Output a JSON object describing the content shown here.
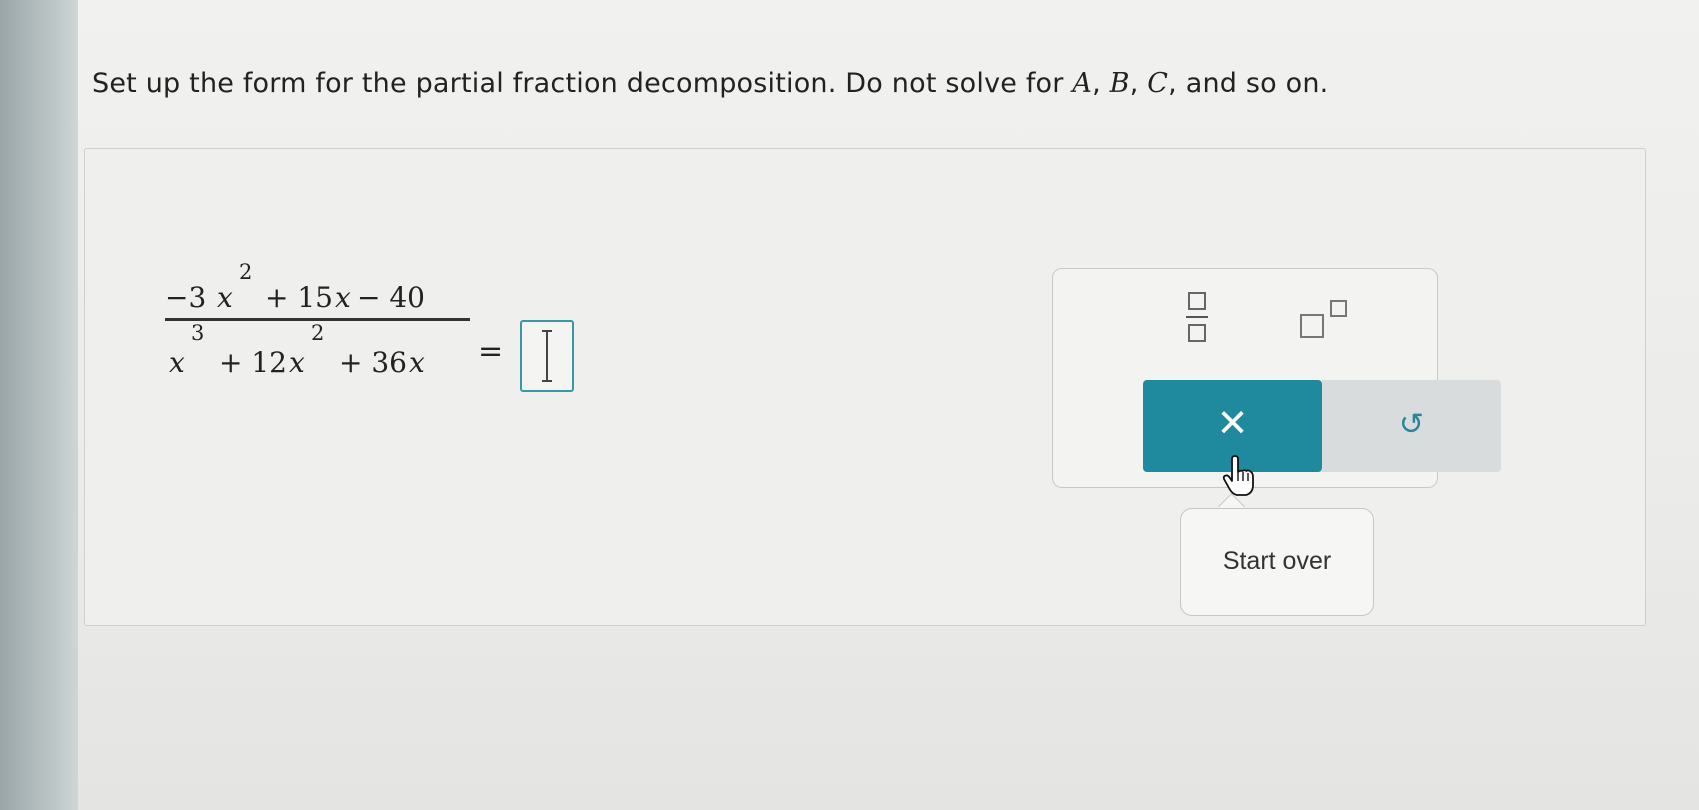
{
  "prompt": {
    "text_before": "Set up the form for the partial fraction decomposition. Do not solve for ",
    "var_a": "A",
    "sep1": ", ",
    "var_b": "B",
    "sep2": ", ",
    "var_c": "C",
    "text_after": ", and so on."
  },
  "expression": {
    "numerator": {
      "t1": "−3",
      "t1_var": "x",
      "t1_exp": "2",
      "t2": "+ 15",
      "t2_var": "x",
      "t3": "− 40"
    },
    "denominator": {
      "t1_var": "x",
      "t1_exp": "3",
      "t2": "+ 12",
      "t2_var": "x",
      "t2_exp": "2",
      "t3": "+ 36",
      "t3_var": "x"
    },
    "equals": "="
  },
  "toolbox": {
    "tools": [
      {
        "name": "fraction-template",
        "icon": "fraction-icon"
      },
      {
        "name": "exponent-template",
        "icon": "superscript-icon"
      }
    ],
    "clear_button": {
      "glyph": "✕",
      "icon": "close-icon",
      "color": "#1f8a9e"
    },
    "undo_button": {
      "glyph": "↺",
      "icon": "undo-icon",
      "color": "#2b8596"
    },
    "tooltip": "Start over"
  },
  "colors": {
    "accent": "#1f8a9e",
    "answer_border": "#3a97a3"
  }
}
